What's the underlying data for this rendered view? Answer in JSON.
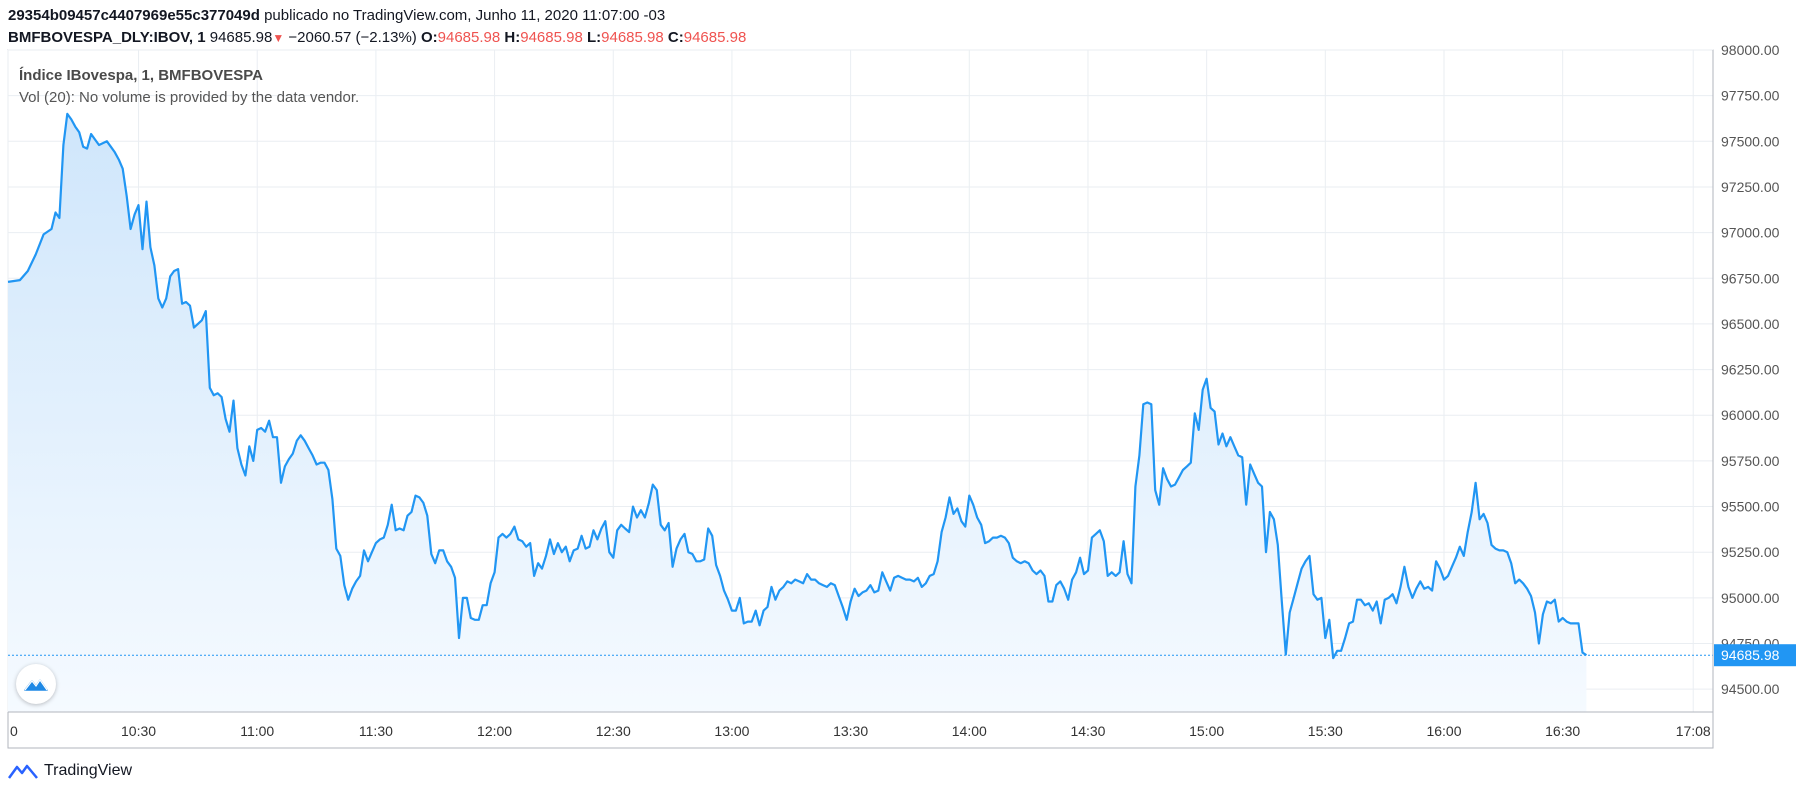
{
  "header": {
    "chart_id": "29354b09457c4407969e55c377049d",
    "published": "publicado no TradingView.com, Junho 11, 2020 11:07:00 -03",
    "symbol": "BMFBOVESPA_DLY:IBOV, 1",
    "last": "94685.98",
    "change": "−2060.57 (−2.13%)",
    "o_label": "O:",
    "o_value": "94685.98",
    "h_label": "H:",
    "h_value": "94685.98",
    "l_label": "L:",
    "l_value": "94685.98",
    "c_label": "C:",
    "c_value": "94685.98"
  },
  "legend": {
    "title": "Índice IBovespa, 1, BMFBOVESPA",
    "volume_note": "Vol (20): No volume is provided by the data vendor."
  },
  "footer": {
    "brand": "TradingView"
  },
  "colors": {
    "line": "#2196f3",
    "fill_top": "#cfe6fb",
    "fill_bottom": "#f5faff",
    "grid": "#eaeef2",
    "price_tag": "#2196f3",
    "down": "#ef5350"
  },
  "icons": {
    "logo_badge": "tradingview-logo-icon",
    "change_arrow": "down-triangle-icon"
  },
  "chart_data": {
    "type": "area",
    "title": "Índice IBovespa, 1, BMFBOVESPA",
    "ylim": [
      94375,
      98000
    ],
    "y_ticks": [
      "98000.00",
      "97750.00",
      "97500.00",
      "97250.00",
      "97000.00",
      "96750.00",
      "96500.00",
      "96250.00",
      "96000.00",
      "95750.00",
      "95500.00",
      "95250.00",
      "95000.00",
      "94750.00",
      "94500.00"
    ],
    "y_tick_values": [
      98000,
      97750,
      97500,
      97250,
      97000,
      96750,
      96500,
      96250,
      96000,
      95750,
      95500,
      95250,
      95000,
      94750,
      94500
    ],
    "x_ticks": [
      "0",
      "10:30",
      "11:00",
      "11:30",
      "12:00",
      "12:30",
      "13:00",
      "13:30",
      "14:00",
      "14:30",
      "15:00",
      "15:30",
      "16:00",
      "16:30",
      "17:08"
    ],
    "x_tick_minutes": [
      -3,
      30,
      60,
      90,
      120,
      150,
      180,
      210,
      240,
      270,
      300,
      330,
      360,
      390,
      423
    ],
    "x_range_minutes": [
      -3,
      428
    ],
    "current_price": 94685.98,
    "current_price_label": "94685.98",
    "grid": true,
    "points": [
      [
        -3,
        96730
      ],
      [
        0,
        96740
      ],
      [
        2,
        96790
      ],
      [
        4,
        96880
      ],
      [
        6,
        96990
      ],
      [
        8,
        97020
      ],
      [
        9,
        97110
      ],
      [
        10,
        97080
      ],
      [
        11,
        97480
      ],
      [
        12,
        97650
      ],
      [
        13,
        97620
      ],
      [
        14,
        97580
      ],
      [
        15,
        97550
      ],
      [
        16,
        97470
      ],
      [
        17,
        97460
      ],
      [
        18,
        97540
      ],
      [
        19,
        97510
      ],
      [
        20,
        97480
      ],
      [
        22,
        97500
      ],
      [
        23,
        97470
      ],
      [
        24,
        97440
      ],
      [
        25,
        97400
      ],
      [
        26,
        97350
      ],
      [
        27,
        97200
      ],
      [
        28,
        97020
      ],
      [
        29,
        97100
      ],
      [
        30,
        97150
      ],
      [
        31,
        96910
      ],
      [
        32,
        97170
      ],
      [
        33,
        96920
      ],
      [
        34,
        96820
      ],
      [
        35,
        96640
      ],
      [
        36,
        96590
      ],
      [
        37,
        96640
      ],
      [
        38,
        96760
      ],
      [
        39,
        96790
      ],
      [
        40,
        96800
      ],
      [
        41,
        96610
      ],
      [
        42,
        96620
      ],
      [
        43,
        96600
      ],
      [
        44,
        96480
      ],
      [
        45,
        96500
      ],
      [
        46,
        96520
      ],
      [
        47,
        96570
      ],
      [
        48,
        96150
      ],
      [
        49,
        96110
      ],
      [
        50,
        96120
      ],
      [
        51,
        96100
      ],
      [
        52,
        95980
      ],
      [
        53,
        95910
      ],
      [
        54,
        96080
      ],
      [
        55,
        95820
      ],
      [
        56,
        95730
      ],
      [
        57,
        95670
      ],
      [
        58,
        95830
      ],
      [
        59,
        95750
      ],
      [
        60,
        95920
      ],
      [
        61,
        95930
      ],
      [
        62,
        95910
      ],
      [
        63,
        95970
      ],
      [
        64,
        95880
      ],
      [
        65,
        95880
      ],
      [
        66,
        95630
      ],
      [
        67,
        95720
      ],
      [
        68,
        95760
      ],
      [
        69,
        95790
      ],
      [
        70,
        95860
      ],
      [
        71,
        95890
      ],
      [
        72,
        95860
      ],
      [
        73,
        95820
      ],
      [
        74,
        95780
      ],
      [
        75,
        95730
      ],
      [
        76,
        95740
      ],
      [
        77,
        95740
      ],
      [
        78,
        95700
      ],
      [
        79,
        95540
      ],
      [
        80,
        95270
      ],
      [
        81,
        95230
      ],
      [
        82,
        95070
      ],
      [
        83,
        94990
      ],
      [
        84,
        95050
      ],
      [
        85,
        95090
      ],
      [
        86,
        95120
      ],
      [
        87,
        95260
      ],
      [
        88,
        95200
      ],
      [
        89,
        95250
      ],
      [
        90,
        95300
      ],
      [
        91,
        95320
      ],
      [
        92,
        95330
      ],
      [
        93,
        95400
      ],
      [
        94,
        95510
      ],
      [
        95,
        95370
      ],
      [
        96,
        95380
      ],
      [
        97,
        95370
      ],
      [
        98,
        95450
      ],
      [
        99,
        95470
      ],
      [
        100,
        95560
      ],
      [
        101,
        95550
      ],
      [
        102,
        95520
      ],
      [
        103,
        95450
      ],
      [
        104,
        95240
      ],
      [
        105,
        95190
      ],
      [
        106,
        95260
      ],
      [
        107,
        95260
      ],
      [
        108,
        95200
      ],
      [
        109,
        95170
      ],
      [
        110,
        95110
      ],
      [
        111,
        94780
      ],
      [
        112,
        95000
      ],
      [
        113,
        95000
      ],
      [
        114,
        94890
      ],
      [
        115,
        94880
      ],
      [
        116,
        94880
      ],
      [
        117,
        94960
      ],
      [
        118,
        94960
      ],
      [
        119,
        95080
      ],
      [
        120,
        95140
      ],
      [
        121,
        95330
      ],
      [
        122,
        95350
      ],
      [
        123,
        95330
      ],
      [
        124,
        95350
      ],
      [
        125,
        95390
      ],
      [
        126,
        95320
      ],
      [
        127,
        95310
      ],
      [
        128,
        95280
      ],
      [
        129,
        95300
      ],
      [
        130,
        95120
      ],
      [
        131,
        95190
      ],
      [
        132,
        95160
      ],
      [
        133,
        95230
      ],
      [
        134,
        95320
      ],
      [
        135,
        95240
      ],
      [
        136,
        95300
      ],
      [
        137,
        95250
      ],
      [
        138,
        95280
      ],
      [
        139,
        95200
      ],
      [
        140,
        95260
      ],
      [
        141,
        95270
      ],
      [
        142,
        95340
      ],
      [
        143,
        95270
      ],
      [
        144,
        95280
      ],
      [
        145,
        95370
      ],
      [
        146,
        95320
      ],
      [
        147,
        95380
      ],
      [
        148,
        95420
      ],
      [
        149,
        95250
      ],
      [
        150,
        95220
      ],
      [
        151,
        95370
      ],
      [
        152,
        95400
      ],
      [
        153,
        95380
      ],
      [
        154,
        95360
      ],
      [
        155,
        95500
      ],
      [
        156,
        95440
      ],
      [
        157,
        95480
      ],
      [
        158,
        95440
      ],
      [
        159,
        95520
      ],
      [
        160,
        95620
      ],
      [
        161,
        95590
      ],
      [
        162,
        95400
      ],
      [
        163,
        95370
      ],
      [
        164,
        95410
      ],
      [
        165,
        95170
      ],
      [
        166,
        95270
      ],
      [
        167,
        95320
      ],
      [
        168,
        95350
      ],
      [
        169,
        95250
      ],
      [
        170,
        95240
      ],
      [
        171,
        95200
      ],
      [
        172,
        95200
      ],
      [
        173,
        95210
      ],
      [
        174,
        95380
      ],
      [
        175,
        95340
      ],
      [
        176,
        95180
      ],
      [
        177,
        95120
      ],
      [
        178,
        95040
      ],
      [
        179,
        94990
      ],
      [
        180,
        94930
      ],
      [
        181,
        94930
      ],
      [
        182,
        95000
      ],
      [
        183,
        94860
      ],
      [
        184,
        94870
      ],
      [
        185,
        94870
      ],
      [
        186,
        94930
      ],
      [
        187,
        94850
      ],
      [
        188,
        94930
      ],
      [
        189,
        94950
      ],
      [
        190,
        95060
      ],
      [
        191,
        94990
      ],
      [
        192,
        95040
      ],
      [
        193,
        95060
      ],
      [
        194,
        95090
      ],
      [
        195,
        95080
      ],
      [
        196,
        95100
      ],
      [
        197,
        95090
      ],
      [
        198,
        95080
      ],
      [
        199,
        95130
      ],
      [
        200,
        95100
      ],
      [
        201,
        95100
      ],
      [
        202,
        95080
      ],
      [
        203,
        95070
      ],
      [
        204,
        95060
      ],
      [
        205,
        95080
      ],
      [
        206,
        95070
      ],
      [
        207,
        95010
      ],
      [
        208,
        94950
      ],
      [
        209,
        94880
      ],
      [
        210,
        94980
      ],
      [
        211,
        95050
      ],
      [
        212,
        95010
      ],
      [
        213,
        95030
      ],
      [
        214,
        95040
      ],
      [
        215,
        95070
      ],
      [
        216,
        95030
      ],
      [
        217,
        95040
      ],
      [
        218,
        95140
      ],
      [
        219,
        95090
      ],
      [
        220,
        95040
      ],
      [
        221,
        95110
      ],
      [
        222,
        95120
      ],
      [
        223,
        95110
      ],
      [
        224,
        95100
      ],
      [
        225,
        95100
      ],
      [
        226,
        95090
      ],
      [
        227,
        95110
      ],
      [
        228,
        95060
      ],
      [
        229,
        95080
      ],
      [
        230,
        95120
      ],
      [
        231,
        95130
      ],
      [
        232,
        95200
      ],
      [
        233,
        95360
      ],
      [
        234,
        95440
      ],
      [
        235,
        95550
      ],
      [
        236,
        95460
      ],
      [
        237,
        95490
      ],
      [
        238,
        95420
      ],
      [
        239,
        95390
      ],
      [
        240,
        95560
      ],
      [
        241,
        95510
      ],
      [
        242,
        95440
      ],
      [
        243,
        95400
      ],
      [
        244,
        95300
      ],
      [
        245,
        95310
      ],
      [
        246,
        95330
      ],
      [
        247,
        95330
      ],
      [
        248,
        95340
      ],
      [
        249,
        95330
      ],
      [
        250,
        95300
      ],
      [
        251,
        95220
      ],
      [
        252,
        95200
      ],
      [
        253,
        95190
      ],
      [
        254,
        95200
      ],
      [
        255,
        95190
      ],
      [
        256,
        95150
      ],
      [
        257,
        95130
      ],
      [
        258,
        95150
      ],
      [
        259,
        95120
      ],
      [
        260,
        94980
      ],
      [
        261,
        94980
      ],
      [
        262,
        95070
      ],
      [
        263,
        95090
      ],
      [
        264,
        95050
      ],
      [
        265,
        94990
      ],
      [
        266,
        95100
      ],
      [
        267,
        95140
      ],
      [
        268,
        95220
      ],
      [
        269,
        95130
      ],
      [
        270,
        95150
      ],
      [
        271,
        95330
      ],
      [
        272,
        95350
      ],
      [
        273,
        95370
      ],
      [
        274,
        95310
      ],
      [
        275,
        95120
      ],
      [
        276,
        95140
      ],
      [
        277,
        95120
      ],
      [
        278,
        95140
      ],
      [
        279,
        95310
      ],
      [
        280,
        95130
      ],
      [
        281,
        95080
      ],
      [
        282,
        95610
      ],
      [
        283,
        95780
      ],
      [
        284,
        96060
      ],
      [
        285,
        96070
      ],
      [
        286,
        96060
      ],
      [
        287,
        95590
      ],
      [
        288,
        95510
      ],
      [
        289,
        95710
      ],
      [
        290,
        95650
      ],
      [
        291,
        95610
      ],
      [
        292,
        95620
      ],
      [
        293,
        95660
      ],
      [
        294,
        95700
      ],
      [
        295,
        95720
      ],
      [
        296,
        95740
      ],
      [
        297,
        96010
      ],
      [
        298,
        95920
      ],
      [
        299,
        96140
      ],
      [
        300,
        96200
      ],
      [
        301,
        96040
      ],
      [
        302,
        96020
      ],
      [
        303,
        95840
      ],
      [
        304,
        95900
      ],
      [
        305,
        95830
      ],
      [
        306,
        95880
      ],
      [
        307,
        95830
      ],
      [
        308,
        95780
      ],
      [
        309,
        95770
      ],
      [
        310,
        95510
      ],
      [
        311,
        95730
      ],
      [
        312,
        95680
      ],
      [
        313,
        95630
      ],
      [
        314,
        95610
      ],
      [
        315,
        95250
      ],
      [
        316,
        95470
      ],
      [
        317,
        95430
      ],
      [
        318,
        95290
      ],
      [
        319,
        94980
      ],
      [
        320,
        94690
      ],
      [
        321,
        94920
      ],
      [
        322,
        95000
      ],
      [
        323,
        95080
      ],
      [
        324,
        95160
      ],
      [
        325,
        95200
      ],
      [
        326,
        95230
      ],
      [
        327,
        95020
      ],
      [
        328,
        94990
      ],
      [
        329,
        95000
      ],
      [
        330,
        94780
      ],
      [
        331,
        94880
      ],
      [
        332,
        94670
      ],
      [
        333,
        94710
      ],
      [
        334,
        94710
      ],
      [
        335,
        94780
      ],
      [
        336,
        94860
      ],
      [
        337,
        94870
      ],
      [
        338,
        94990
      ],
      [
        339,
        94990
      ],
      [
        340,
        94960
      ],
      [
        341,
        94970
      ],
      [
        342,
        94930
      ],
      [
        343,
        94980
      ],
      [
        344,
        94860
      ],
      [
        345,
        94990
      ],
      [
        346,
        95000
      ],
      [
        347,
        95020
      ],
      [
        348,
        94970
      ],
      [
        349,
        95060
      ],
      [
        350,
        95170
      ],
      [
        351,
        95060
      ],
      [
        352,
        95000
      ],
      [
        353,
        95050
      ],
      [
        354,
        95090
      ],
      [
        355,
        95050
      ],
      [
        356,
        95060
      ],
      [
        357,
        95040
      ],
      [
        358,
        95200
      ],
      [
        359,
        95160
      ],
      [
        360,
        95100
      ],
      [
        361,
        95120
      ],
      [
        362,
        95170
      ],
      [
        363,
        95220
      ],
      [
        364,
        95280
      ],
      [
        365,
        95230
      ],
      [
        366,
        95360
      ],
      [
        367,
        95470
      ],
      [
        368,
        95630
      ],
      [
        369,
        95430
      ],
      [
        370,
        95460
      ],
      [
        371,
        95410
      ],
      [
        372,
        95290
      ],
      [
        373,
        95270
      ],
      [
        374,
        95260
      ],
      [
        375,
        95260
      ],
      [
        376,
        95250
      ],
      [
        377,
        95190
      ],
      [
        378,
        95080
      ],
      [
        379,
        95100
      ],
      [
        380,
        95080
      ],
      [
        381,
        95050
      ],
      [
        382,
        95010
      ],
      [
        383,
        94920
      ],
      [
        384,
        94750
      ],
      [
        385,
        94910
      ],
      [
        386,
        94980
      ],
      [
        387,
        94970
      ],
      [
        388,
        94990
      ],
      [
        389,
        94870
      ],
      [
        390,
        94890
      ],
      [
        391,
        94870
      ],
      [
        392,
        94860
      ],
      [
        393,
        94860
      ],
      [
        394,
        94860
      ],
      [
        395,
        94700
      ],
      [
        396,
        94686
      ]
    ]
  }
}
